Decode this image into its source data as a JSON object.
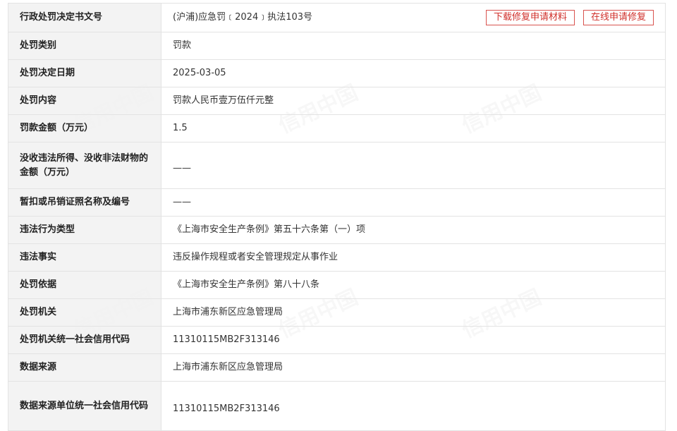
{
  "buttons": {
    "download": "下载修复申请材料",
    "online": "在线申请修复"
  },
  "watermark_text": "信用中国",
  "rows": [
    {
      "label": "行政处罚决定书文号",
      "value": "(沪浦)应急罚﹝2024﹞执法103号"
    },
    {
      "label": "处罚类别",
      "value": "罚款"
    },
    {
      "label": "处罚决定日期",
      "value": "2025-03-05"
    },
    {
      "label": "处罚内容",
      "value": "罚款人民币壹万伍仟元整"
    },
    {
      "label": "罚款金额（万元）",
      "value": "1.5"
    },
    {
      "label": "没收违法所得、没收非法财物的金额（万元）",
      "value": "——"
    },
    {
      "label": "暂扣或吊销证照名称及编号",
      "value": "——"
    },
    {
      "label": "违法行为类型",
      "value": "《上海市安全生产条例》第五十六条第（一）项"
    },
    {
      "label": "违法事实",
      "value": "违反操作规程或者安全管理规定从事作业"
    },
    {
      "label": "处罚依据",
      "value": "《上海市安全生产条例》第八十八条"
    },
    {
      "label": "处罚机关",
      "value": "上海市浦东新区应急管理局"
    },
    {
      "label": "处罚机关统一社会信用代码",
      "value": "11310115MB2F313146"
    },
    {
      "label": "数据来源",
      "value": "上海市浦东新区应急管理局"
    },
    {
      "label": "数据来源单位统一社会信用代码",
      "value": "11310115MB2F313146"
    }
  ]
}
